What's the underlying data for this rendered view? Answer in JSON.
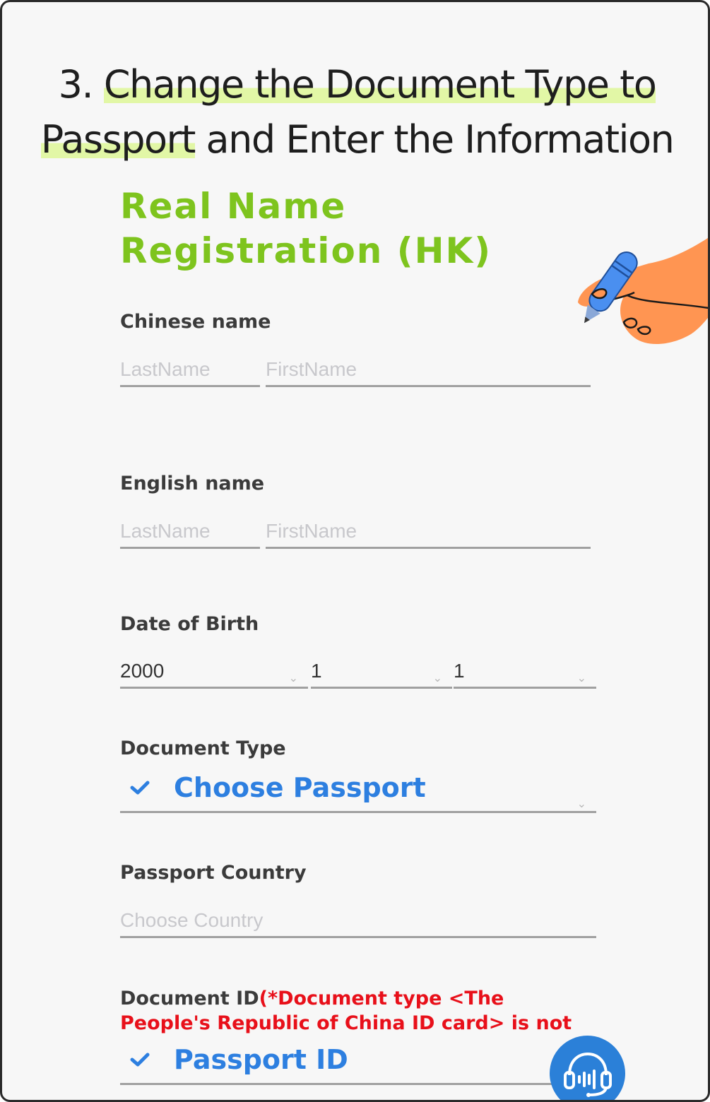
{
  "headline": {
    "number": "3. ",
    "highlight1": "Change the Document Type to",
    "highlight2": "Passport",
    "rest": " and Enter the Information"
  },
  "form": {
    "title": "Real Name Registration (HK)",
    "chinese_name": {
      "label": "Chinese name",
      "lastname_placeholder": "LastName",
      "firstname_placeholder": "FirstName"
    },
    "english_name": {
      "label": "English name",
      "lastname_placeholder": "LastName",
      "firstname_placeholder": "FirstName"
    },
    "date_of_birth": {
      "label": "Date of Birth",
      "year": "2000",
      "month": "1",
      "day": "1"
    },
    "document_type": {
      "label": "Document Type",
      "callout": "Choose Passport"
    },
    "passport_country": {
      "label": "Passport Country",
      "placeholder": "Choose Country"
    },
    "document_id": {
      "label": "Document ID",
      "note": "(*Document type <The People's Republic of China ID card> is not supported.)",
      "callout": "Passport ID"
    }
  },
  "colors": {
    "accent_green": "#7ec41e",
    "highlight": "#e2f7a6",
    "callout_blue": "#2d7fe0",
    "warning_red": "#e8101a",
    "support_blue": "#2b80d8"
  },
  "icons": {
    "hand": "hand-with-pen-icon",
    "check": "check-icon",
    "chevron": "chevron-down-icon",
    "support": "headset-support-icon"
  }
}
